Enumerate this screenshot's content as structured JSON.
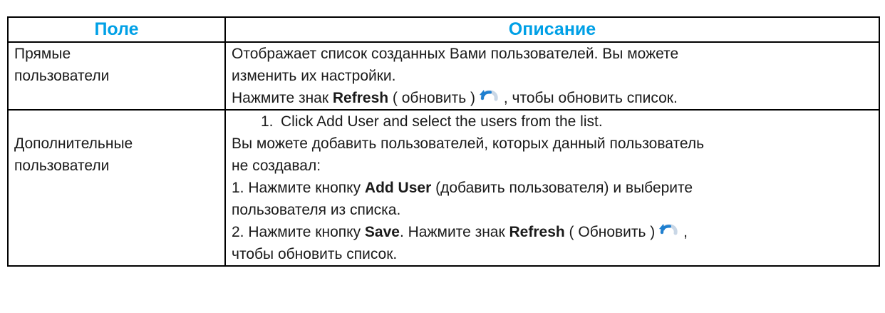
{
  "table": {
    "header": {
      "col1": "Поле",
      "col2": "Описание"
    },
    "row1": {
      "field_line1": "Прямые",
      "field_line2": "пользователи",
      "desc_line1": "Отображает список созданных Вами пользователей. Вы можете",
      "desc_line2": "изменить их настройки.",
      "desc_line3_pre": "Нажмите знак ",
      "desc_line3_bold": "Refresh",
      "desc_line3_mid": " ( обновить )",
      "desc_line3_post": " , чтобы обновить список."
    },
    "row2": {
      "field_line1": "Дополнительные",
      "field_line2": "пользователи",
      "list_num": "1.",
      "list_text": "Click Add User and select the users from the list.",
      "desc_line2": "Вы можете добавить пользователей, которых данный пользователь",
      "desc_line3": "не создавал:",
      "desc_line4_pre": "1. Нажмите кнопку ",
      "desc_line4_bold": "Add User",
      "desc_line4_post": " (добавить пользователя) и выберите",
      "desc_line5": "пользователя из списка.",
      "desc_line6_pre": "2. Нажмите кнопку ",
      "desc_line6_bold1": "Save",
      "desc_line6_mid": ". Нажмите знак ",
      "desc_line6_bold2": "Refresh",
      "desc_line6_mid2": " ( Обновить )",
      "desc_line6_post": " ,",
      "desc_line7": "чтобы обновить список."
    }
  },
  "icons": {
    "refresh": "refresh-icon"
  },
  "colors": {
    "header_text": "#00a0e6",
    "border": "#000000",
    "icon_blue": "#1e7fd0"
  }
}
